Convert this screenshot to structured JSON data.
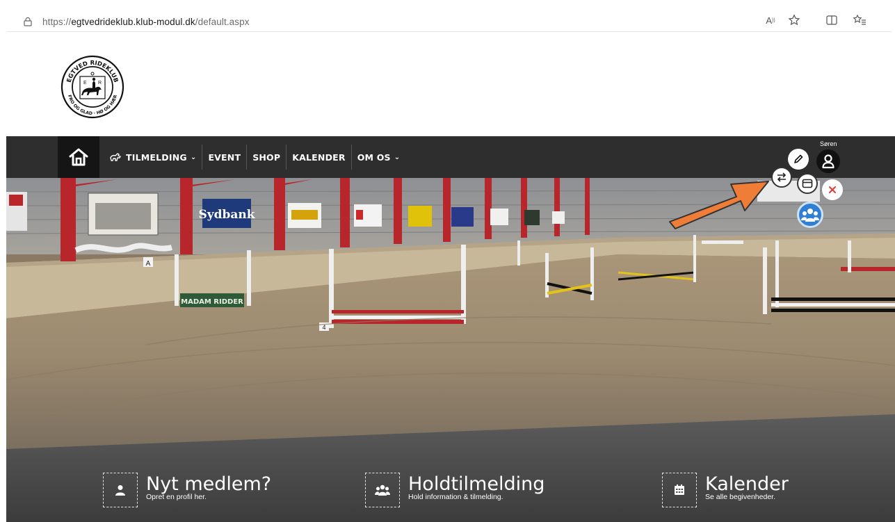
{
  "browser": {
    "url_scheme": "https://",
    "url_host": "egtvedrideklub.klub-modul.dk",
    "url_path": "/default.aspx",
    "icons": [
      "lock-icon",
      "read-aloud-icon",
      "favorite-star-icon",
      "split-screen-icon",
      "favorites-list-icon"
    ],
    "read_aloud_label": "A"
  },
  "logo": {
    "ring_text_top": "EGTVED RIDEKLUB",
    "ring_text_bottom": "FRO OG GLAD · HØ OG HÆR",
    "inner_letters": [
      "E",
      "R"
    ]
  },
  "nav": {
    "items": [
      {
        "label": "TILMELDING",
        "has_dropdown": true,
        "icon": "horse-icon"
      },
      {
        "label": "EVENT",
        "has_dropdown": false
      },
      {
        "label": "SHOP",
        "has_dropdown": false
      },
      {
        "label": "KALENDER",
        "has_dropdown": false
      },
      {
        "label": "OM OS",
        "has_dropdown": true
      }
    ],
    "user_name": "Søren"
  },
  "hero": {
    "banners": [
      "Sydbank",
      "MADAM RIDDER"
    ],
    "arena_markers": [
      "A",
      "4"
    ]
  },
  "quicklinks": [
    {
      "title": "Nyt medlem?",
      "subtitle": "Opret en profil her.",
      "icon": "person-icon"
    },
    {
      "title": "Holdtilmelding",
      "subtitle": "Hold information & tilmelding.",
      "icon": "group-icon"
    },
    {
      "title": "Kalender",
      "subtitle": "Se alle begivenheder.",
      "icon": "calendar-icon"
    }
  ],
  "colors": {
    "nav_bg": "#2e2e2e",
    "home_bg": "#151515",
    "arrow": "#f07d37",
    "close": "#e53935",
    "beam_red": "#b8252a"
  }
}
